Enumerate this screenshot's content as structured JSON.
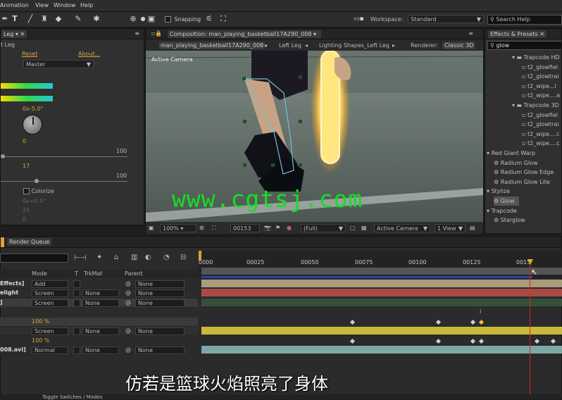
{
  "menu": {
    "items": [
      "Animation",
      "View",
      "Window",
      "Help"
    ]
  },
  "toolbar": {
    "snapping": "Snapping",
    "workspace_label": "Workspace:",
    "workspace_value": "Standard",
    "search_placeholder": "Search Help"
  },
  "effect_controls": {
    "tab_left": "Leg",
    "layer_label": "t Leg",
    "reset": "Reset",
    "about": "About...",
    "master": "Master",
    "angle": "0x-5.0°",
    "val0": "0",
    "val100a": "100",
    "val17": "17",
    "val100b": "100",
    "colorize": "Colorize",
    "hue": "0x+0.0°",
    "val25": "25",
    "valzero": "0"
  },
  "composition": {
    "tab": "Composition: man_playing_basketball17A290_008",
    "crumbs": [
      "man_playing_basketball17A290_008",
      "Left Leg",
      "Lighting Shapes_Left Leg"
    ],
    "renderer_label": "Renderer:",
    "renderer_value": "Classic 3D",
    "active_camera": "Active Camera",
    "zoom": "100%",
    "timecode": "00153",
    "resolution": "(Full)",
    "view_camera": "Active Camera",
    "views": "1 View"
  },
  "effects_presets": {
    "tab": "Effects & Presets",
    "search": "glow",
    "items": [
      {
        "label": "Trapcode HD P",
        "level": 1,
        "type": "folder"
      },
      {
        "label": "t2_glowfiel",
        "level": 2,
        "type": "preset"
      },
      {
        "label": "t2_glowtrai",
        "level": 2,
        "type": "preset"
      },
      {
        "label": "t2_wipe...l",
        "level": 2,
        "type": "preset"
      },
      {
        "label": "t2_wipe....a",
        "level": 2,
        "type": "preset"
      },
      {
        "label": "Trapcode 3D P",
        "level": 1,
        "type": "folder"
      },
      {
        "label": "t2_glowfiel",
        "level": 2,
        "type": "preset"
      },
      {
        "label": "t2_glowtrai",
        "level": 2,
        "type": "preset"
      },
      {
        "label": "t2_wipe....c",
        "level": 2,
        "type": "preset"
      },
      {
        "label": "t2_wipe....c",
        "level": 2,
        "type": "preset"
      },
      {
        "label": "Red Giant Warp",
        "level": 0,
        "type": "category"
      },
      {
        "label": "Radium Glow",
        "level": 1,
        "type": "effect"
      },
      {
        "label": "Radium Glow Edge",
        "level": 1,
        "type": "effect"
      },
      {
        "label": "Radium Glow Lite",
        "level": 1,
        "type": "effect"
      },
      {
        "label": "Stylize",
        "level": 0,
        "type": "category"
      },
      {
        "label": "Glow",
        "level": 1,
        "type": "effect"
      },
      {
        "label": "Trapcode",
        "level": 0,
        "type": "category"
      },
      {
        "label": "Starglow",
        "level": 1,
        "type": "effect"
      }
    ]
  },
  "timeline": {
    "render_queue_tab": "Render Queue",
    "headers": {
      "mode": "Mode",
      "t": "T",
      "trkmat": "TrkMat",
      "parent": "Parent"
    },
    "rows": [
      {
        "name": "Effects]",
        "mode": "Add",
        "trkmat": "",
        "parent": "None"
      },
      {
        "name": "elight",
        "mode": "Screen",
        "trkmat": "None",
        "parent": "None"
      },
      {
        "name": "]",
        "mode": "Screen",
        "trkmat": "None",
        "parent": "None"
      },
      {
        "name": "",
        "mode": "",
        "trkmat": "",
        "parent": "",
        "value": "100 %"
      },
      {
        "name": "",
        "mode": "Screen",
        "trkmat": "None",
        "parent": "None"
      },
      {
        "name": "",
        "mode": "",
        "trkmat": "",
        "parent": "",
        "value": "100 %"
      },
      {
        "name": "008.avi]",
        "mode": "Normal",
        "trkmat": "None",
        "parent": "None"
      }
    ],
    "ruler": [
      "0000",
      "00025",
      "00050",
      "00075",
      "00100",
      "00125",
      "0015"
    ],
    "bottom_label": "Toggle Switches / Modes"
  },
  "watermark": "www.cgtsj.com",
  "subtitle": "仿若是篮球火焰照亮了身体"
}
